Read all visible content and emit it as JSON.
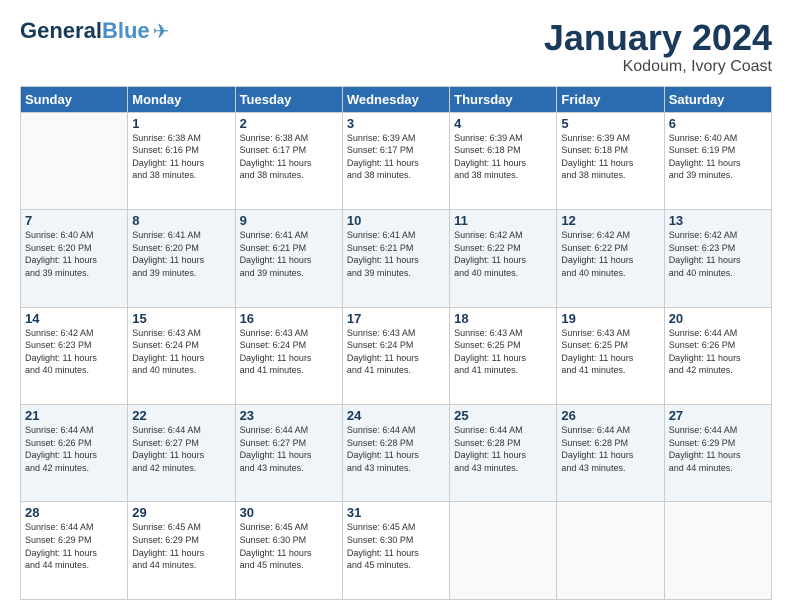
{
  "header": {
    "logo_general": "General",
    "logo_blue": "Blue",
    "title": "January 2024",
    "subtitle": "Kodoum, Ivory Coast"
  },
  "calendar": {
    "days_of_week": [
      "Sunday",
      "Monday",
      "Tuesday",
      "Wednesday",
      "Thursday",
      "Friday",
      "Saturday"
    ],
    "weeks": [
      [
        {
          "day": "",
          "info": ""
        },
        {
          "day": "1",
          "info": "Sunrise: 6:38 AM\nSunset: 6:16 PM\nDaylight: 11 hours\nand 38 minutes."
        },
        {
          "day": "2",
          "info": "Sunrise: 6:38 AM\nSunset: 6:17 PM\nDaylight: 11 hours\nand 38 minutes."
        },
        {
          "day": "3",
          "info": "Sunrise: 6:39 AM\nSunset: 6:17 PM\nDaylight: 11 hours\nand 38 minutes."
        },
        {
          "day": "4",
          "info": "Sunrise: 6:39 AM\nSunset: 6:18 PM\nDaylight: 11 hours\nand 38 minutes."
        },
        {
          "day": "5",
          "info": "Sunrise: 6:39 AM\nSunset: 6:18 PM\nDaylight: 11 hours\nand 38 minutes."
        },
        {
          "day": "6",
          "info": "Sunrise: 6:40 AM\nSunset: 6:19 PM\nDaylight: 11 hours\nand 39 minutes."
        }
      ],
      [
        {
          "day": "7",
          "info": "Sunrise: 6:40 AM\nSunset: 6:20 PM\nDaylight: 11 hours\nand 39 minutes."
        },
        {
          "day": "8",
          "info": "Sunrise: 6:41 AM\nSunset: 6:20 PM\nDaylight: 11 hours\nand 39 minutes."
        },
        {
          "day": "9",
          "info": "Sunrise: 6:41 AM\nSunset: 6:21 PM\nDaylight: 11 hours\nand 39 minutes."
        },
        {
          "day": "10",
          "info": "Sunrise: 6:41 AM\nSunset: 6:21 PM\nDaylight: 11 hours\nand 39 minutes."
        },
        {
          "day": "11",
          "info": "Sunrise: 6:42 AM\nSunset: 6:22 PM\nDaylight: 11 hours\nand 40 minutes."
        },
        {
          "day": "12",
          "info": "Sunrise: 6:42 AM\nSunset: 6:22 PM\nDaylight: 11 hours\nand 40 minutes."
        },
        {
          "day": "13",
          "info": "Sunrise: 6:42 AM\nSunset: 6:23 PM\nDaylight: 11 hours\nand 40 minutes."
        }
      ],
      [
        {
          "day": "14",
          "info": "Sunrise: 6:42 AM\nSunset: 6:23 PM\nDaylight: 11 hours\nand 40 minutes."
        },
        {
          "day": "15",
          "info": "Sunrise: 6:43 AM\nSunset: 6:24 PM\nDaylight: 11 hours\nand 40 minutes."
        },
        {
          "day": "16",
          "info": "Sunrise: 6:43 AM\nSunset: 6:24 PM\nDaylight: 11 hours\nand 41 minutes."
        },
        {
          "day": "17",
          "info": "Sunrise: 6:43 AM\nSunset: 6:24 PM\nDaylight: 11 hours\nand 41 minutes."
        },
        {
          "day": "18",
          "info": "Sunrise: 6:43 AM\nSunset: 6:25 PM\nDaylight: 11 hours\nand 41 minutes."
        },
        {
          "day": "19",
          "info": "Sunrise: 6:43 AM\nSunset: 6:25 PM\nDaylight: 11 hours\nand 41 minutes."
        },
        {
          "day": "20",
          "info": "Sunrise: 6:44 AM\nSunset: 6:26 PM\nDaylight: 11 hours\nand 42 minutes."
        }
      ],
      [
        {
          "day": "21",
          "info": "Sunrise: 6:44 AM\nSunset: 6:26 PM\nDaylight: 11 hours\nand 42 minutes."
        },
        {
          "day": "22",
          "info": "Sunrise: 6:44 AM\nSunset: 6:27 PM\nDaylight: 11 hours\nand 42 minutes."
        },
        {
          "day": "23",
          "info": "Sunrise: 6:44 AM\nSunset: 6:27 PM\nDaylight: 11 hours\nand 43 minutes."
        },
        {
          "day": "24",
          "info": "Sunrise: 6:44 AM\nSunset: 6:28 PM\nDaylight: 11 hours\nand 43 minutes."
        },
        {
          "day": "25",
          "info": "Sunrise: 6:44 AM\nSunset: 6:28 PM\nDaylight: 11 hours\nand 43 minutes."
        },
        {
          "day": "26",
          "info": "Sunrise: 6:44 AM\nSunset: 6:28 PM\nDaylight: 11 hours\nand 43 minutes."
        },
        {
          "day": "27",
          "info": "Sunrise: 6:44 AM\nSunset: 6:29 PM\nDaylight: 11 hours\nand 44 minutes."
        }
      ],
      [
        {
          "day": "28",
          "info": "Sunrise: 6:44 AM\nSunset: 6:29 PM\nDaylight: 11 hours\nand 44 minutes."
        },
        {
          "day": "29",
          "info": "Sunrise: 6:45 AM\nSunset: 6:29 PM\nDaylight: 11 hours\nand 44 minutes."
        },
        {
          "day": "30",
          "info": "Sunrise: 6:45 AM\nSunset: 6:30 PM\nDaylight: 11 hours\nand 45 minutes."
        },
        {
          "day": "31",
          "info": "Sunrise: 6:45 AM\nSunset: 6:30 PM\nDaylight: 11 hours\nand 45 minutes."
        },
        {
          "day": "",
          "info": ""
        },
        {
          "day": "",
          "info": ""
        },
        {
          "day": "",
          "info": ""
        }
      ]
    ]
  }
}
